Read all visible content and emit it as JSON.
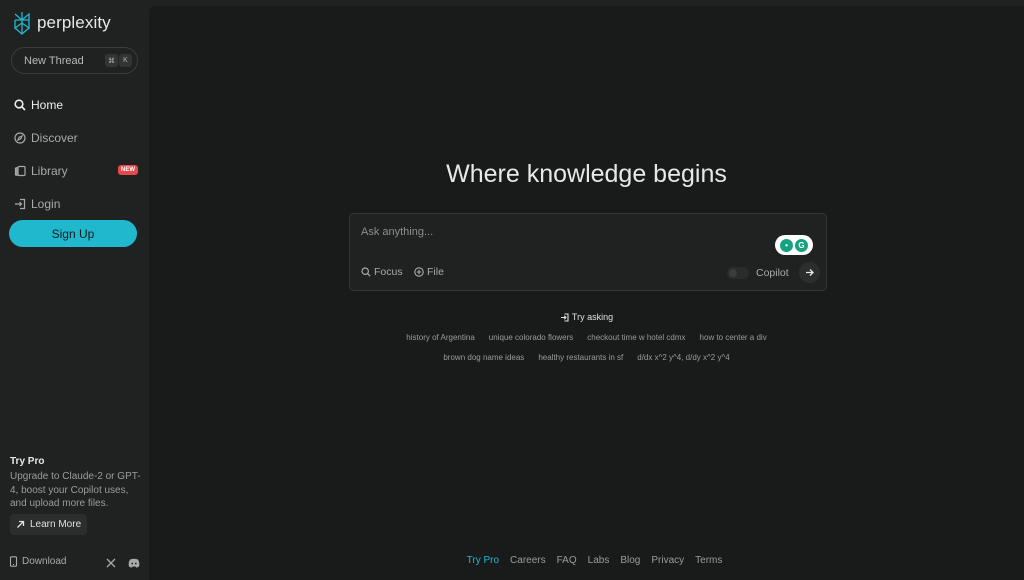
{
  "brand": {
    "name": "perplexity",
    "accent": "#20b8cd"
  },
  "sidebar": {
    "new_thread": {
      "label": "New Thread",
      "shortcut": [
        "⌘",
        "K"
      ]
    },
    "items": [
      {
        "label": "Home",
        "icon": "search-icon",
        "active": true
      },
      {
        "label": "Discover",
        "icon": "compass-icon"
      },
      {
        "label": "Library",
        "icon": "library-icon",
        "badge": "NEW"
      },
      {
        "label": "Login",
        "icon": "login-icon"
      }
    ],
    "signup_label": "Sign Up",
    "try_pro": {
      "title": "Try Pro",
      "text": "Upgrade to Claude-2 or GPT-4, boost your Copilot uses, and upload more files.",
      "button": "Learn More"
    },
    "download_label": "Download"
  },
  "main": {
    "headline": "Where knowledge begins",
    "search": {
      "placeholder": "Ask anything...",
      "focus_label": "Focus",
      "file_label": "File",
      "copilot_label": "Copilot"
    },
    "try_asking_label": "Try asking",
    "suggestions_row1": [
      "history of Argentina",
      "unique colorado flowers",
      "checkout time w hotel cdmx",
      "how to center a div"
    ],
    "suggestions_row2": [
      "brown dog name ideas",
      "healthy restaurants in sf",
      "d/dx x^2 y^4, d/dy x^2 y^4"
    ],
    "footer_links": [
      "Try Pro",
      "Careers",
      "FAQ",
      "Labs",
      "Blog",
      "Privacy",
      "Terms"
    ]
  }
}
